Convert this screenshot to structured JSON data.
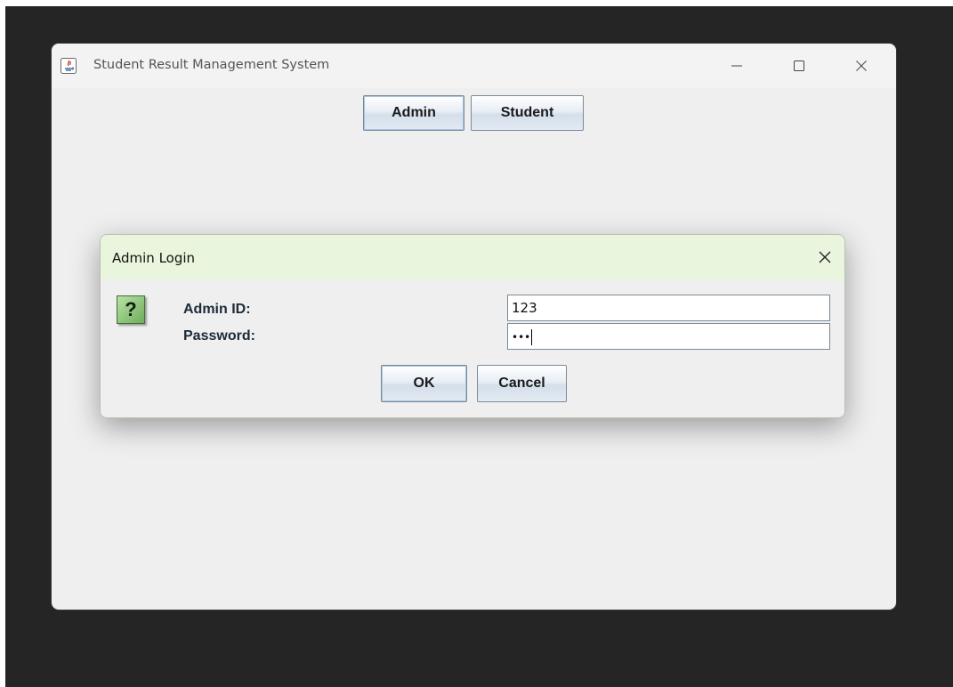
{
  "main_window": {
    "title": "Student Result Management System",
    "icon": "java-app-icon",
    "controls": {
      "minimize_icon": "minimize-icon",
      "maximize_icon": "maximize-icon",
      "close_icon": "close-icon"
    },
    "buttons": {
      "admin_label": "Admin",
      "student_label": "Student"
    }
  },
  "dialog": {
    "title": "Admin Login",
    "icon": "question-icon",
    "question_glyph": "?",
    "fields": {
      "admin_id_label": "Admin ID:",
      "admin_id_value": "123",
      "password_label": "Password:",
      "password_value": "•••"
    },
    "buttons": {
      "ok_label": "OK",
      "cancel_label": "Cancel"
    }
  },
  "colors": {
    "backdrop": "#252525",
    "window_bg": "#efefef",
    "dialog_titlebar": "#e9f5dc",
    "button_border": "#7a8a99",
    "label_text": "#1e2a38"
  }
}
